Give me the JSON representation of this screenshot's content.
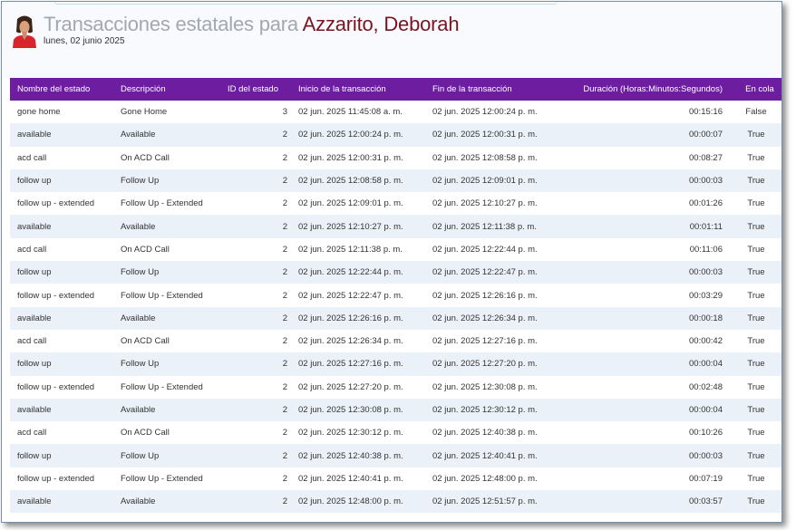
{
  "header": {
    "title_prefix": "Transacciones estatales para ",
    "agent_name": "Azzarito, Deborah",
    "date": "lunes, 02 junio 2025"
  },
  "colors": {
    "header_bar": "#6d1ea0",
    "agent_name": "#7b1420",
    "row_alt": "#eaf1f9"
  },
  "table": {
    "columns": [
      "Nombre del estado",
      "Descripción",
      "ID del estado",
      "Inicio de la transacción",
      "Fin de la transacción",
      "Duración (Horas:Minutos:Segundos)",
      "En cola"
    ],
    "rows": [
      {
        "state": "gone home",
        "description": "Gone Home",
        "id": "3",
        "start": "02 jun. 2025 11:45:08 a. m.",
        "end": "02 jun. 2025 12:00:24 p. m.",
        "duration": "00:15:16",
        "queue": "False"
      },
      {
        "state": "available",
        "description": "Available",
        "id": "2",
        "start": "02 jun. 2025 12:00:24 p. m.",
        "end": "02 jun. 2025 12:00:31 p. m.",
        "duration": "00:00:07",
        "queue": "True"
      },
      {
        "state": "acd call",
        "description": "On ACD Call",
        "id": "2",
        "start": "02 jun. 2025 12:00:31 p. m.",
        "end": "02 jun. 2025 12:08:58 p. m.",
        "duration": "00:08:27",
        "queue": "True"
      },
      {
        "state": "follow up",
        "description": "Follow Up",
        "id": "2",
        "start": "02 jun. 2025 12:08:58 p. m.",
        "end": "02 jun. 2025 12:09:01 p. m.",
        "duration": "00:00:03",
        "queue": "True"
      },
      {
        "state": "follow up - extended",
        "description": "Follow Up - Extended",
        "id": "2",
        "start": "02 jun. 2025 12:09:01 p. m.",
        "end": "02 jun. 2025 12:10:27 p. m.",
        "duration": "00:01:26",
        "queue": "True"
      },
      {
        "state": "available",
        "description": "Available",
        "id": "2",
        "start": "02 jun. 2025 12:10:27 p. m.",
        "end": "02 jun. 2025 12:11:38 p. m.",
        "duration": "00:01:11",
        "queue": "True"
      },
      {
        "state": "acd call",
        "description": "On ACD Call",
        "id": "2",
        "start": "02 jun. 2025 12:11:38 p. m.",
        "end": "02 jun. 2025 12:22:44 p. m.",
        "duration": "00:11:06",
        "queue": "True"
      },
      {
        "state": "follow up",
        "description": "Follow Up",
        "id": "2",
        "start": "02 jun. 2025 12:22:44 p. m.",
        "end": "02 jun. 2025 12:22:47 p. m.",
        "duration": "00:00:03",
        "queue": "True"
      },
      {
        "state": "follow up - extended",
        "description": "Follow Up - Extended",
        "id": "2",
        "start": "02 jun. 2025 12:22:47 p. m.",
        "end": "02 jun. 2025 12:26:16 p. m.",
        "duration": "00:03:29",
        "queue": "True"
      },
      {
        "state": "available",
        "description": "Available",
        "id": "2",
        "start": "02 jun. 2025 12:26:16 p. m.",
        "end": "02 jun. 2025 12:26:34 p. m.",
        "duration": "00:00:18",
        "queue": "True"
      },
      {
        "state": "acd call",
        "description": "On ACD Call",
        "id": "2",
        "start": "02 jun. 2025 12:26:34 p. m.",
        "end": "02 jun. 2025 12:27:16 p. m.",
        "duration": "00:00:42",
        "queue": "True"
      },
      {
        "state": "follow up",
        "description": "Follow Up",
        "id": "2",
        "start": "02 jun. 2025 12:27:16 p. m.",
        "end": "02 jun. 2025 12:27:20 p. m.",
        "duration": "00:00:04",
        "queue": "True"
      },
      {
        "state": "follow up - extended",
        "description": "Follow Up - Extended",
        "id": "2",
        "start": "02 jun. 2025 12:27:20 p. m.",
        "end": "02 jun. 2025 12:30:08 p. m.",
        "duration": "00:02:48",
        "queue": "True"
      },
      {
        "state": "available",
        "description": "Available",
        "id": "2",
        "start": "02 jun. 2025 12:30:08 p. m.",
        "end": "02 jun. 2025 12:30:12 p. m.",
        "duration": "00:00:04",
        "queue": "True"
      },
      {
        "state": "acd call",
        "description": "On ACD Call",
        "id": "2",
        "start": "02 jun. 2025 12:30:12 p. m.",
        "end": "02 jun. 2025 12:40:38 p. m.",
        "duration": "00:10:26",
        "queue": "True"
      },
      {
        "state": "follow up",
        "description": "Follow Up",
        "id": "2",
        "start": "02 jun. 2025 12:40:38 p. m.",
        "end": "02 jun. 2025 12:40:41 p. m.",
        "duration": "00:00:03",
        "queue": "True"
      },
      {
        "state": "follow up - extended",
        "description": "Follow Up - Extended",
        "id": "2",
        "start": "02 jun. 2025 12:40:41 p. m.",
        "end": "02 jun. 2025 12:48:00 p. m.",
        "duration": "00:07:19",
        "queue": "True"
      },
      {
        "state": "available",
        "description": "Available",
        "id": "2",
        "start": "02 jun. 2025 12:48:00 p. m.",
        "end": "02 jun. 2025 12:51:57 p. m.",
        "duration": "00:03:57",
        "queue": "True"
      }
    ]
  }
}
